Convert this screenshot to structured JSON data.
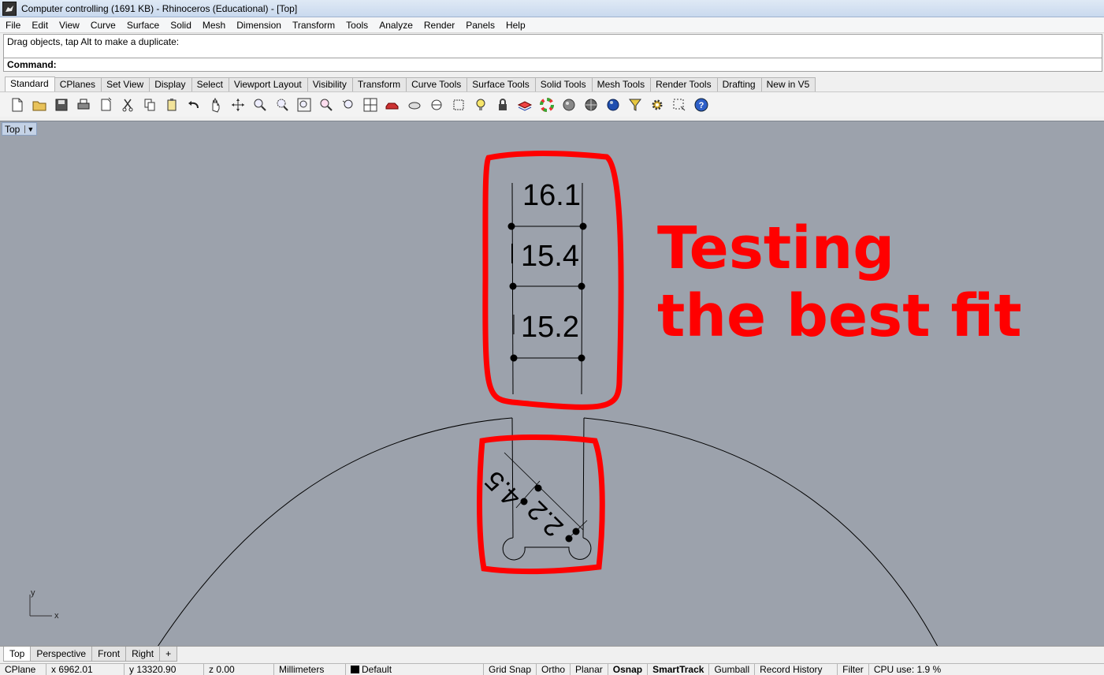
{
  "window": {
    "title": "Computer controlling (1691 KB) - Rhinoceros (Educational) - [Top]"
  },
  "menu": [
    "File",
    "Edit",
    "View",
    "Curve",
    "Surface",
    "Solid",
    "Mesh",
    "Dimension",
    "Transform",
    "Tools",
    "Analyze",
    "Render",
    "Panels",
    "Help"
  ],
  "command_history": "Drag objects, tap Alt to make a duplicate:",
  "command_prompt": "Command:",
  "toolbar_tabs": [
    "Standard",
    "CPlanes",
    "Set View",
    "Display",
    "Select",
    "Viewport Layout",
    "Visibility",
    "Transform",
    "Curve Tools",
    "Surface Tools",
    "Solid Tools",
    "Mesh Tools",
    "Render Tools",
    "Drafting",
    "New in V5"
  ],
  "toolbar_icons": [
    "new-file-icon",
    "open-file-icon",
    "save-icon",
    "print-icon",
    "import-icon",
    "cut-icon",
    "copy-icon",
    "paste-icon",
    "undo-icon",
    "pan-icon",
    "rotate-view-icon",
    "zoom-icon",
    "zoom-window-icon",
    "zoom-extents-icon",
    "zoom-selected-icon",
    "undo-view-icon",
    "four-viewports-icon",
    "car-icon",
    "display-icon",
    "ghosted-icon",
    "xray-icon",
    "light-icon",
    "lock-icon",
    "layer-icon",
    "color-wheel-icon",
    "shaded-icon",
    "rendered-icon",
    "render-icon",
    "filter-icon",
    "settings-icon",
    "select-icon",
    "help-icon"
  ],
  "viewport": {
    "name": "Top",
    "dimensions": [
      "16.1",
      "15.4",
      "15.2"
    ],
    "angled_dimensions": [
      "4.5",
      "2.2"
    ],
    "annotation": [
      "Testing",
      "the best fit"
    ],
    "axis_labels": {
      "y": "y",
      "x": "x"
    },
    "colors": {
      "background": "#9ca2ac",
      "markup": "#ff0000",
      "geometry": "#000000"
    }
  },
  "viewport_tabs": [
    "Top",
    "Perspective",
    "Front",
    "Right",
    "+"
  ],
  "status": {
    "cplane": "CPlane",
    "x": "x 6962.01",
    "y": "y 13320.90",
    "z": "z 0.00",
    "units": "Millimeters",
    "layer": "Default",
    "toggles": [
      "Grid Snap",
      "Ortho",
      "Planar",
      "Osnap",
      "SmartTrack",
      "Gumball",
      "Record History",
      "Filter"
    ],
    "cpu": "CPU use: 1.9 %"
  }
}
